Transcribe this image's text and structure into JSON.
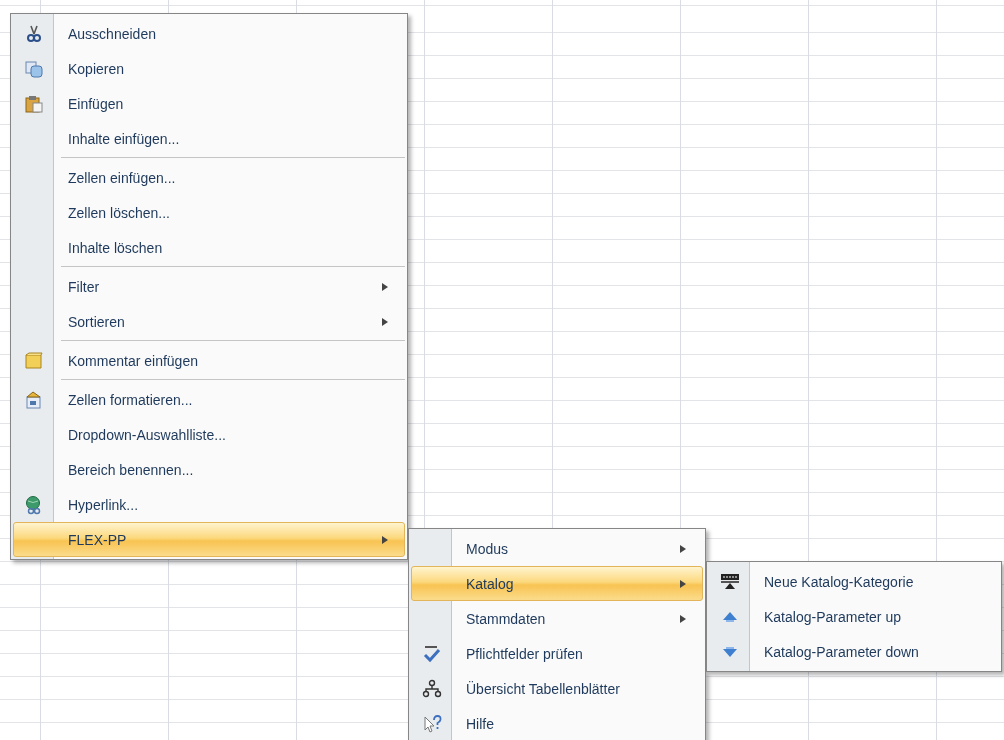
{
  "menus": [
    {
      "items": [
        {
          "kind": "scissors",
          "label": "Ausschneiden",
          "submenu": false,
          "selected": false
        },
        {
          "kind": "copy",
          "label": "Kopieren",
          "submenu": false,
          "selected": false
        },
        {
          "kind": "paste",
          "label": "Einfügen",
          "submenu": false,
          "selected": false
        },
        {
          "kind": "text",
          "label": "Inhalte einfügen...",
          "submenu": false,
          "selected": false
        },
        {
          "kind": "separator"
        },
        {
          "kind": "text",
          "label": "Zellen einfügen...",
          "submenu": false,
          "selected": false
        },
        {
          "kind": "text",
          "label": "Zellen löschen...",
          "submenu": false,
          "selected": false
        },
        {
          "kind": "text",
          "label": "Inhalte löschen",
          "submenu": false,
          "selected": false
        },
        {
          "kind": "separator"
        },
        {
          "kind": "text",
          "label": "Filter",
          "submenu": true,
          "selected": false
        },
        {
          "kind": "text",
          "label": "Sortieren",
          "submenu": true,
          "selected": false
        },
        {
          "kind": "separator"
        },
        {
          "kind": "note",
          "label": "Kommentar einfügen",
          "submenu": false,
          "selected": false
        },
        {
          "kind": "separator"
        },
        {
          "kind": "format",
          "label": "Zellen formatieren...",
          "submenu": false,
          "selected": false
        },
        {
          "kind": "text",
          "label": "Dropdown-Auswahlliste...",
          "submenu": false,
          "selected": false
        },
        {
          "kind": "text",
          "label": "Bereich benennen...",
          "submenu": false,
          "selected": false
        },
        {
          "kind": "globe",
          "label": "Hyperlink...",
          "submenu": false,
          "selected": false
        },
        {
          "kind": "text",
          "label": "FLEX-PP",
          "submenu": true,
          "selected": true
        }
      ]
    },
    {
      "items": [
        {
          "kind": "text",
          "label": "Modus",
          "submenu": true,
          "selected": false
        },
        {
          "kind": "text",
          "label": "Katalog",
          "submenu": true,
          "selected": true
        },
        {
          "kind": "text",
          "label": "Stammdaten",
          "submenu": true,
          "selected": false
        },
        {
          "kind": "spellcheck",
          "label": "Pflichtfelder prüfen",
          "submenu": false,
          "selected": false
        },
        {
          "kind": "tree",
          "label": "Übersicht Tabellenblätter",
          "submenu": false,
          "selected": false
        },
        {
          "kind": "help",
          "label": "Hilfe",
          "submenu": false,
          "selected": false
        }
      ]
    },
    {
      "items": [
        {
          "kind": "toolbar",
          "label": "Neue Katalog-Kategorie",
          "submenu": false,
          "selected": false
        },
        {
          "kind": "up",
          "label": "Katalog-Parameter up",
          "submenu": false,
          "selected": false
        },
        {
          "kind": "down",
          "label": "Katalog-Parameter down",
          "submenu": false,
          "selected": false
        }
      ]
    }
  ]
}
